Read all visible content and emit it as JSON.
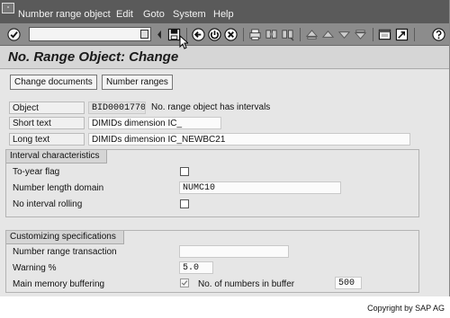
{
  "menu": [
    "Number range object",
    "Edit",
    "Goto",
    "System",
    "Help"
  ],
  "toolbar": {
    "command_field": "",
    "icons": [
      "enter-icon",
      "save-icon",
      "back-icon",
      "exit-icon",
      "cancel-icon",
      "print-icon",
      "find-icon",
      "find-next-icon",
      "first-page-icon",
      "previous-page-icon",
      "next-page-icon",
      "last-page-icon",
      "create-session-icon",
      "shortcut-icon",
      "help-icon"
    ]
  },
  "title": "No. Range Object: Change",
  "buttons": {
    "change_documents": "Change documents",
    "number_ranges": "Number ranges"
  },
  "object": {
    "label": "Object",
    "value": "BID0001770",
    "info": "No. range object has intervals"
  },
  "short_text": {
    "label": "Short text",
    "value": "DIMIDs dimension IC_"
  },
  "long_text": {
    "label": "Long text",
    "value": "DIMIDs dimension IC_NEWBC21"
  },
  "interval": {
    "title": "Interval characteristics",
    "to_year_flag": {
      "label": "To-year flag",
      "checked": false
    },
    "number_length_domain": {
      "label": "Number length domain",
      "value": "NUMC10"
    },
    "no_interval_rolling": {
      "label": "No interval rolling",
      "checked": false
    }
  },
  "customizing": {
    "title": "Customizing specifications",
    "number_range_transaction": {
      "label": "Number range transaction",
      "value": ""
    },
    "warning": {
      "label": "Warning %",
      "value": "5.0"
    },
    "main_memory_buffering": {
      "label": "Main memory buffering",
      "checked": true
    },
    "numbers_in_buffer": {
      "label": "No. of numbers in buffer",
      "value": "500"
    }
  },
  "copyright": "Copyright by SAP AG"
}
